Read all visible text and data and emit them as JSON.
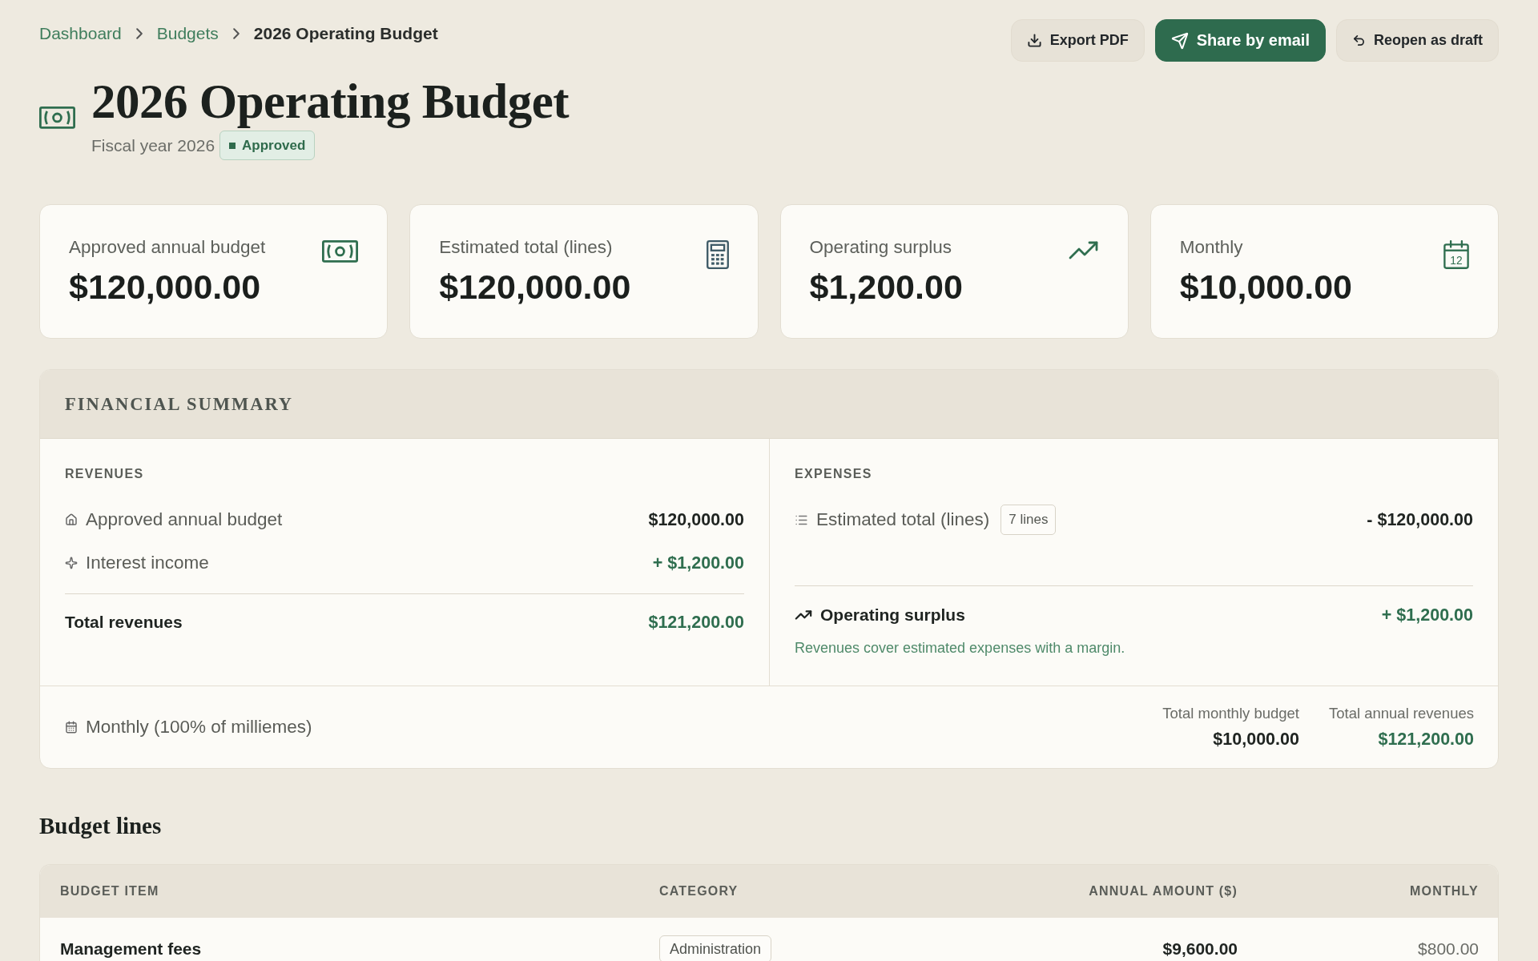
{
  "breadcrumb": [
    {
      "label": "Dashboard",
      "kind": "link"
    },
    {
      "label": "Budgets",
      "kind": "link"
    },
    {
      "label": "2026 Operating Budget",
      "kind": "current"
    }
  ],
  "actions": [
    {
      "label": "Export PDF",
      "kind": "secondary"
    },
    {
      "label": "Share by email",
      "kind": "primary"
    },
    {
      "label": "Reopen as draft",
      "kind": "secondary"
    }
  ],
  "title": "2026 Operating Budget",
  "subtitle": "Fiscal year 2026",
  "status": {
    "label": "Approved",
    "kind": "approved"
  },
  "stats": [
    {
      "label": "Approved annual budget",
      "value": "$120,000.00"
    },
    {
      "label": "Estimated total (lines)",
      "value": "$120,000.00"
    },
    {
      "label": "Operating surplus",
      "value": "$1,200.00"
    },
    {
      "label": "Monthly",
      "value": "$10,000.00",
      "icon_text": "12"
    }
  ],
  "financial_summary": {
    "title": "FINANCIAL SUMMARY",
    "revenues": {
      "heading": "REVENUES",
      "items": [
        {
          "label": "Approved annual budget",
          "amount": "$120,000.00",
          "kind": "neutral"
        },
        {
          "label": "Interest income",
          "amount": "+ $1,200.00",
          "kind": "positive"
        }
      ],
      "total": {
        "label": "Total revenues",
        "amount": "$121,200.00",
        "kind": "positive"
      }
    },
    "expenses": {
      "heading": "EXPENSES",
      "items": [
        {
          "label": "Estimated total (lines)",
          "badge": "7 lines",
          "amount": "- $120,000.00",
          "kind": "neutral"
        }
      ],
      "result": {
        "label": "Operating surplus",
        "amount": "+ $1,200.00",
        "kind": "positive",
        "note": "Revenues cover estimated expenses with a margin."
      }
    },
    "footer": {
      "label": "Monthly (100% of milliemes)",
      "totals": [
        {
          "label": "Total monthly budget",
          "value": "$10,000.00",
          "kind": "neutral"
        },
        {
          "label": "Total annual revenues",
          "value": "$121,200.00",
          "kind": "positive"
        }
      ]
    }
  },
  "budget_lines": {
    "title": "Budget lines",
    "columns": [
      "BUDGET ITEM",
      "CATEGORY",
      "ANNUAL AMOUNT ($)",
      "MONTHLY"
    ],
    "rows": [
      {
        "item": "Management fees",
        "category": "Administration",
        "annual": "$9,600.00",
        "monthly": "$800.00"
      }
    ]
  }
}
